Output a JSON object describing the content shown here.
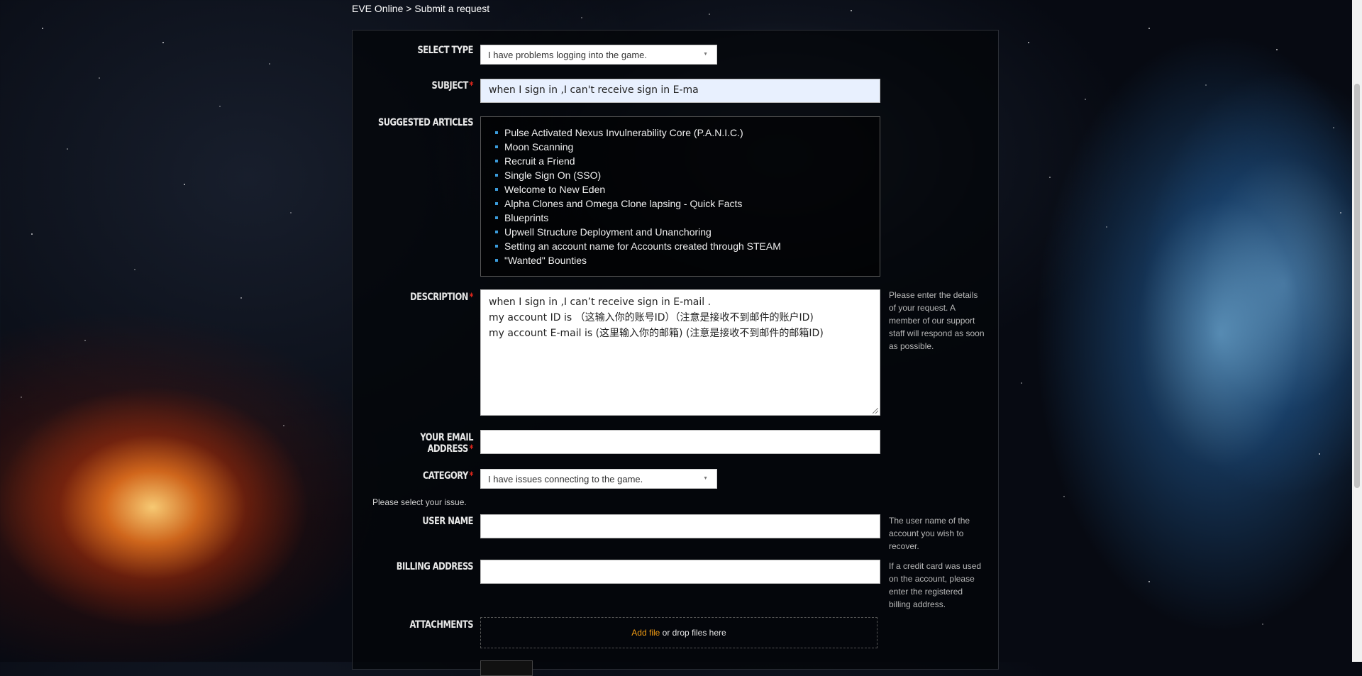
{
  "breadcrumb": {
    "home": "EVE Online",
    "separator": ">",
    "current": "Submit a request"
  },
  "form": {
    "select_type": {
      "label": "SELECT TYPE",
      "value": "I have problems logging into the game."
    },
    "subject": {
      "label": "SUBJECT",
      "required_mark": "*",
      "value": "when I sign in ,I can't receive sign in E-ma"
    },
    "suggested_articles": {
      "label": "SUGGESTED ARTICLES",
      "items": [
        "Pulse Activated Nexus Invulnerability Core (P.A.N.I.C.)",
        "Moon Scanning",
        "Recruit a Friend",
        "Single Sign On (SSO)",
        "Welcome to New Eden",
        "Alpha Clones and Omega Clone lapsing - Quick Facts",
        "Blueprints",
        "Upwell Structure Deployment and Unanchoring",
        "Setting an account name for Accounts created through STEAM",
        "\"Wanted\" Bounties"
      ]
    },
    "description": {
      "label": "DESCRIPTION",
      "required_mark": "*",
      "lines": [
        "when I sign in ,I can’t receive sign in E-mail .",
        "my account ID is （这输入你的账号ID）（注意是接收不到邮件的账户ID)",
        "my account E-mail is (这里输入你的邮箱) (注意是接收不到邮件的邮箱ID)"
      ],
      "help": "Please enter the details of your request. A member of our support staff will respond as soon as possible."
    },
    "email": {
      "label": "YOUR EMAIL ADDRESS",
      "required_mark": "*",
      "value": ""
    },
    "category": {
      "label": "CATEGORY",
      "required_mark": "*",
      "value": "I have issues connecting to the game.",
      "note": "Please select your issue."
    },
    "user_name": {
      "label": "USER NAME",
      "value": "",
      "help": "The user name of the account you wish to recover."
    },
    "billing_address": {
      "label": "BILLING ADDRESS",
      "value": "",
      "help": "If a credit card was used on the account, please enter the registered billing address."
    },
    "attachments": {
      "label": "ATTACHMENTS",
      "add_file": "Add file",
      "drop_text": " or drop files here"
    }
  },
  "colors": {
    "required": "#e0271c",
    "bullet": "#3a9ad9",
    "add_file": "#f39c12"
  }
}
